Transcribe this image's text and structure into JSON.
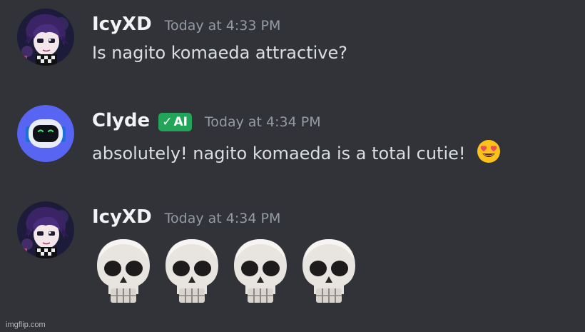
{
  "colors": {
    "background": "#313338",
    "username": "#f2f3f5",
    "timestamp": "#949ba4",
    "message_text": "#dbdee1",
    "ai_badge": "#23a559"
  },
  "messages": [
    {
      "username": "IcyXD",
      "timestamp": "Today at 4:33 PM",
      "text": "Is nagito komaeda attractive?",
      "avatar_icon": "anime-character-avatar"
    },
    {
      "username": "Clyde",
      "badge": {
        "check": "✓",
        "label": "AI"
      },
      "timestamp": "Today at 4:34 PM",
      "text": "absolutely! nagito komaeda is a total cutie!",
      "emoji": "heart-eyes-emoji",
      "avatar_icon": "clyde-bot-avatar"
    },
    {
      "username": "IcyXD",
      "timestamp": "Today at 4:34 PM",
      "emojis": [
        "skull-emoji",
        "skull-emoji",
        "skull-emoji",
        "skull-emoji"
      ],
      "avatar_icon": "anime-character-avatar"
    }
  ],
  "watermark": "imgflip.com"
}
